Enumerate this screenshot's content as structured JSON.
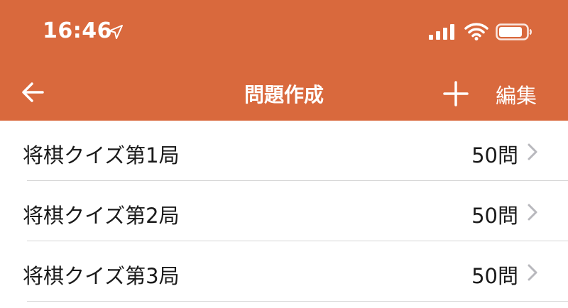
{
  "status_bar": {
    "time": "16:46",
    "icons": [
      "location-arrow-icon",
      "signal-icon",
      "wifi-icon",
      "battery-icon"
    ]
  },
  "nav_bar": {
    "title": "問題作成",
    "edit_label": "編集",
    "back_icon": "back-arrow-icon",
    "add_icon": "plus-icon"
  },
  "list": {
    "items": [
      {
        "label": "将棋クイズ第1局",
        "count": "50問"
      },
      {
        "label": "将棋クイズ第2局",
        "count": "50問"
      },
      {
        "label": "将棋クイズ第3局",
        "count": "50問"
      }
    ]
  },
  "colors": {
    "header": "#d9693d",
    "text": "#1a1a1a",
    "chevron": "#b8b8bd",
    "separator": "#d6d6d6"
  }
}
